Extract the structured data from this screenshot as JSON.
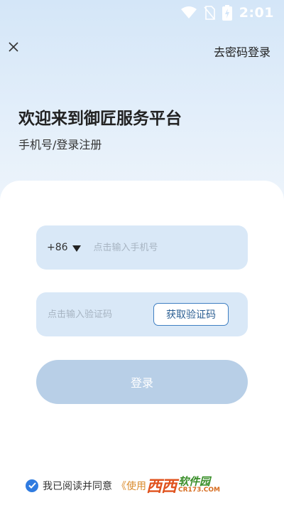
{
  "status_bar": {
    "time": "2:01",
    "icons": [
      "wifi-icon",
      "no-sim-icon",
      "battery-charging-icon"
    ]
  },
  "header": {
    "close_icon": "close-icon",
    "password_login": "去密码登录"
  },
  "welcome": {
    "title": "欢迎来到御匠服务平台",
    "subtitle": "手机号/登录注册"
  },
  "form": {
    "country_code": "+86",
    "phone_placeholder": "点击输入手机号",
    "code_placeholder": "点击输入验证码",
    "get_code_label": "获取验证码",
    "login_label": "登录"
  },
  "agreement": {
    "checked": true,
    "text": "我已阅读并同意",
    "link_text": "《使用"
  },
  "watermark": {
    "mark": "西西",
    "name": "软件园",
    "url": "CR173.COM"
  },
  "colors": {
    "accent": "#2f7be0",
    "field_bg": "#d9e8f7",
    "login_btn": "#b8cfe7",
    "link": "#d98a2b"
  }
}
